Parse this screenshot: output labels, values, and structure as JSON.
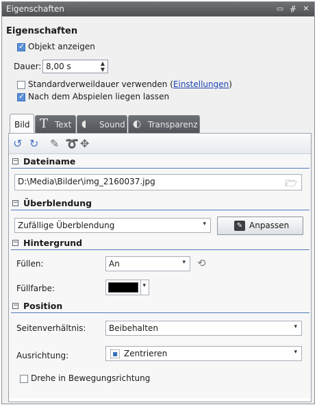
{
  "window": {
    "title": "Eigenschaften",
    "buttons": [
      "▭",
      "ᚌ",
      "✕"
    ]
  },
  "heading": "Eigenschaften",
  "show_object": {
    "label": "Objekt anzeigen",
    "checked": true
  },
  "duration": {
    "label": "Dauer:",
    "value": "8,00 s"
  },
  "standard": {
    "label": "Standardverweildauer verwenden (",
    "link": "Einstellungen",
    "suffix": ")",
    "checked": false
  },
  "after_play": {
    "label": "Nach dem Abspielen liegen lassen",
    "checked": true
  },
  "tabs": [
    {
      "label": "Bild",
      "icon": "",
      "active": true
    },
    {
      "label": "Text",
      "icon": "T",
      "active": false
    },
    {
      "label": "Sound",
      "icon": "◖",
      "active": false
    },
    {
      "label": "Transparenz",
      "icon": "◐",
      "active": false
    }
  ],
  "toolbar": {
    "icons": [
      "rotate-left-icon",
      "rotate-right-icon",
      "brush-icon",
      "lasso-icon",
      "move-icon"
    ]
  },
  "sections": {
    "dateiname": {
      "title": "Dateiname",
      "path": "D:\\Media\\Bilder\\img_2160037.jpg"
    },
    "ueberblendung": {
      "title": "Überblendung",
      "value": "Zufällige Überblendung",
      "button": "Anpassen"
    },
    "hintergrund": {
      "title": "Hintergrund",
      "fill_label": "Füllen:",
      "fill_value": "An",
      "color_label": "Füllfarbe:",
      "color": "#000000"
    },
    "position": {
      "title": "Position",
      "aspect_label": "Seitenverhältnis:",
      "aspect_value": "Beibehalten",
      "align_label": "Ausrichtung:",
      "align_value": "Zentrieren",
      "rotate_label": "Drehe in Bewegungsrichtung",
      "rotate_checked": false
    }
  },
  "colors": {
    "accent": "#4e7bbb",
    "titlebar": "#5f6164"
  }
}
